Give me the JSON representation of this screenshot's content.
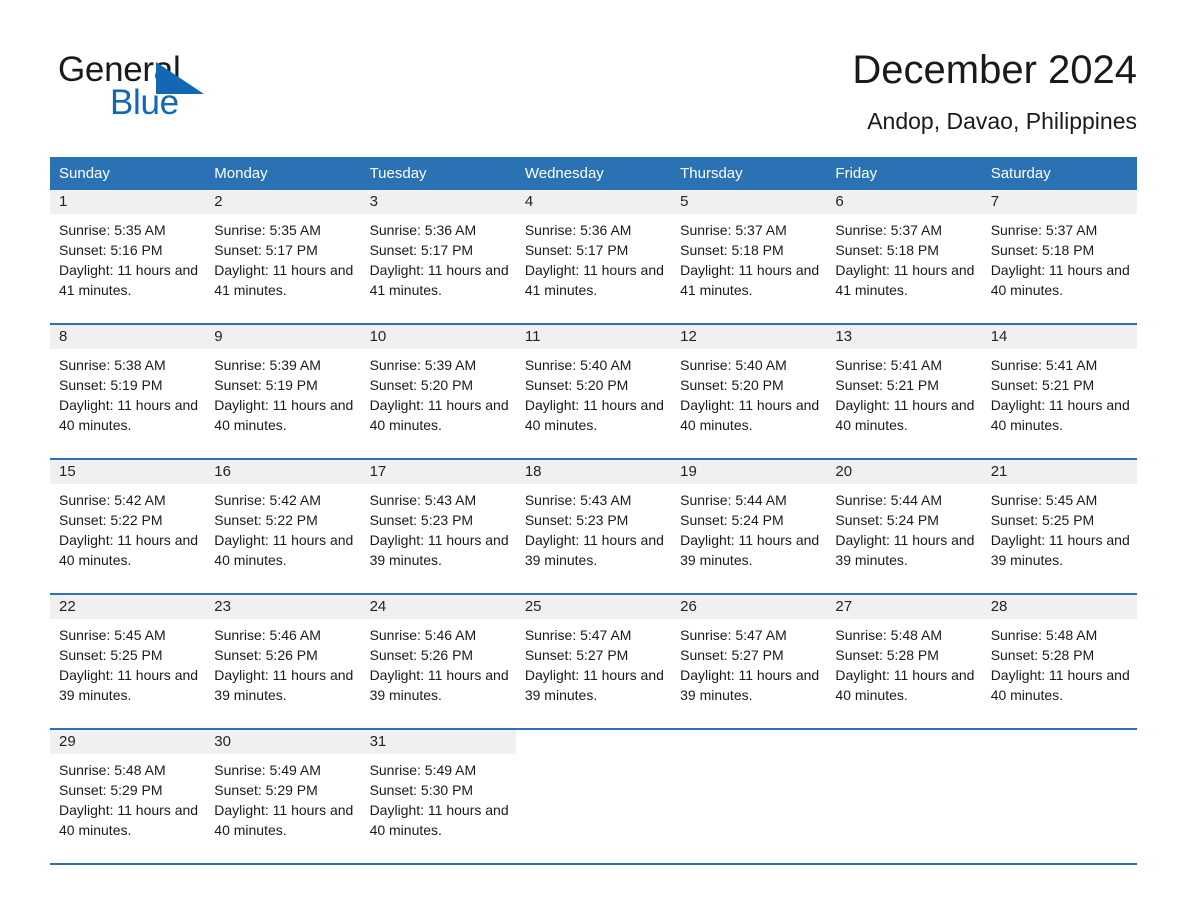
{
  "brand": {
    "name_part1": "General",
    "name_part2": "Blue",
    "triangle_color": "#1268b3",
    "text_color": "#1a1a1a"
  },
  "header": {
    "title": "December 2024",
    "subtitle": "Andop, Davao, Philippines"
  },
  "theme": {
    "header_blue": "#2b72b5",
    "daynum_band": "#f0f0f0",
    "text": "#1a1a1a"
  },
  "weekdays": [
    "Sunday",
    "Monday",
    "Tuesday",
    "Wednesday",
    "Thursday",
    "Friday",
    "Saturday"
  ],
  "weeks": [
    [
      {
        "day": "1",
        "sunrise": "Sunrise: 5:35 AM",
        "sunset": "Sunset: 5:16 PM",
        "daylight": "Daylight: 11 hours and 41 minutes."
      },
      {
        "day": "2",
        "sunrise": "Sunrise: 5:35 AM",
        "sunset": "Sunset: 5:17 PM",
        "daylight": "Daylight: 11 hours and 41 minutes."
      },
      {
        "day": "3",
        "sunrise": "Sunrise: 5:36 AM",
        "sunset": "Sunset: 5:17 PM",
        "daylight": "Daylight: 11 hours and 41 minutes."
      },
      {
        "day": "4",
        "sunrise": "Sunrise: 5:36 AM",
        "sunset": "Sunset: 5:17 PM",
        "daylight": "Daylight: 11 hours and 41 minutes."
      },
      {
        "day": "5",
        "sunrise": "Sunrise: 5:37 AM",
        "sunset": "Sunset: 5:18 PM",
        "daylight": "Daylight: 11 hours and 41 minutes."
      },
      {
        "day": "6",
        "sunrise": "Sunrise: 5:37 AM",
        "sunset": "Sunset: 5:18 PM",
        "daylight": "Daylight: 11 hours and 41 minutes."
      },
      {
        "day": "7",
        "sunrise": "Sunrise: 5:37 AM",
        "sunset": "Sunset: 5:18 PM",
        "daylight": "Daylight: 11 hours and 40 minutes."
      }
    ],
    [
      {
        "day": "8",
        "sunrise": "Sunrise: 5:38 AM",
        "sunset": "Sunset: 5:19 PM",
        "daylight": "Daylight: 11 hours and 40 minutes."
      },
      {
        "day": "9",
        "sunrise": "Sunrise: 5:39 AM",
        "sunset": "Sunset: 5:19 PM",
        "daylight": "Daylight: 11 hours and 40 minutes."
      },
      {
        "day": "10",
        "sunrise": "Sunrise: 5:39 AM",
        "sunset": "Sunset: 5:20 PM",
        "daylight": "Daylight: 11 hours and 40 minutes."
      },
      {
        "day": "11",
        "sunrise": "Sunrise: 5:40 AM",
        "sunset": "Sunset: 5:20 PM",
        "daylight": "Daylight: 11 hours and 40 minutes."
      },
      {
        "day": "12",
        "sunrise": "Sunrise: 5:40 AM",
        "sunset": "Sunset: 5:20 PM",
        "daylight": "Daylight: 11 hours and 40 minutes."
      },
      {
        "day": "13",
        "sunrise": "Sunrise: 5:41 AM",
        "sunset": "Sunset: 5:21 PM",
        "daylight": "Daylight: 11 hours and 40 minutes."
      },
      {
        "day": "14",
        "sunrise": "Sunrise: 5:41 AM",
        "sunset": "Sunset: 5:21 PM",
        "daylight": "Daylight: 11 hours and 40 minutes."
      }
    ],
    [
      {
        "day": "15",
        "sunrise": "Sunrise: 5:42 AM",
        "sunset": "Sunset: 5:22 PM",
        "daylight": "Daylight: 11 hours and 40 minutes."
      },
      {
        "day": "16",
        "sunrise": "Sunrise: 5:42 AM",
        "sunset": "Sunset: 5:22 PM",
        "daylight": "Daylight: 11 hours and 40 minutes."
      },
      {
        "day": "17",
        "sunrise": "Sunrise: 5:43 AM",
        "sunset": "Sunset: 5:23 PM",
        "daylight": "Daylight: 11 hours and 39 minutes."
      },
      {
        "day": "18",
        "sunrise": "Sunrise: 5:43 AM",
        "sunset": "Sunset: 5:23 PM",
        "daylight": "Daylight: 11 hours and 39 minutes."
      },
      {
        "day": "19",
        "sunrise": "Sunrise: 5:44 AM",
        "sunset": "Sunset: 5:24 PM",
        "daylight": "Daylight: 11 hours and 39 minutes."
      },
      {
        "day": "20",
        "sunrise": "Sunrise: 5:44 AM",
        "sunset": "Sunset: 5:24 PM",
        "daylight": "Daylight: 11 hours and 39 minutes."
      },
      {
        "day": "21",
        "sunrise": "Sunrise: 5:45 AM",
        "sunset": "Sunset: 5:25 PM",
        "daylight": "Daylight: 11 hours and 39 minutes."
      }
    ],
    [
      {
        "day": "22",
        "sunrise": "Sunrise: 5:45 AM",
        "sunset": "Sunset: 5:25 PM",
        "daylight": "Daylight: 11 hours and 39 minutes."
      },
      {
        "day": "23",
        "sunrise": "Sunrise: 5:46 AM",
        "sunset": "Sunset: 5:26 PM",
        "daylight": "Daylight: 11 hours and 39 minutes."
      },
      {
        "day": "24",
        "sunrise": "Sunrise: 5:46 AM",
        "sunset": "Sunset: 5:26 PM",
        "daylight": "Daylight: 11 hours and 39 minutes."
      },
      {
        "day": "25",
        "sunrise": "Sunrise: 5:47 AM",
        "sunset": "Sunset: 5:27 PM",
        "daylight": "Daylight: 11 hours and 39 minutes."
      },
      {
        "day": "26",
        "sunrise": "Sunrise: 5:47 AM",
        "sunset": "Sunset: 5:27 PM",
        "daylight": "Daylight: 11 hours and 39 minutes."
      },
      {
        "day": "27",
        "sunrise": "Sunrise: 5:48 AM",
        "sunset": "Sunset: 5:28 PM",
        "daylight": "Daylight: 11 hours and 40 minutes."
      },
      {
        "day": "28",
        "sunrise": "Sunrise: 5:48 AM",
        "sunset": "Sunset: 5:28 PM",
        "daylight": "Daylight: 11 hours and 40 minutes."
      }
    ],
    [
      {
        "day": "29",
        "sunrise": "Sunrise: 5:48 AM",
        "sunset": "Sunset: 5:29 PM",
        "daylight": "Daylight: 11 hours and 40 minutes."
      },
      {
        "day": "30",
        "sunrise": "Sunrise: 5:49 AM",
        "sunset": "Sunset: 5:29 PM",
        "daylight": "Daylight: 11 hours and 40 minutes."
      },
      {
        "day": "31",
        "sunrise": "Sunrise: 5:49 AM",
        "sunset": "Sunset: 5:30 PM",
        "daylight": "Daylight: 11 hours and 40 minutes."
      },
      {
        "day": "",
        "sunrise": "",
        "sunset": "",
        "daylight": ""
      },
      {
        "day": "",
        "sunrise": "",
        "sunset": "",
        "daylight": ""
      },
      {
        "day": "",
        "sunrise": "",
        "sunset": "",
        "daylight": ""
      },
      {
        "day": "",
        "sunrise": "",
        "sunset": "",
        "daylight": ""
      }
    ]
  ]
}
